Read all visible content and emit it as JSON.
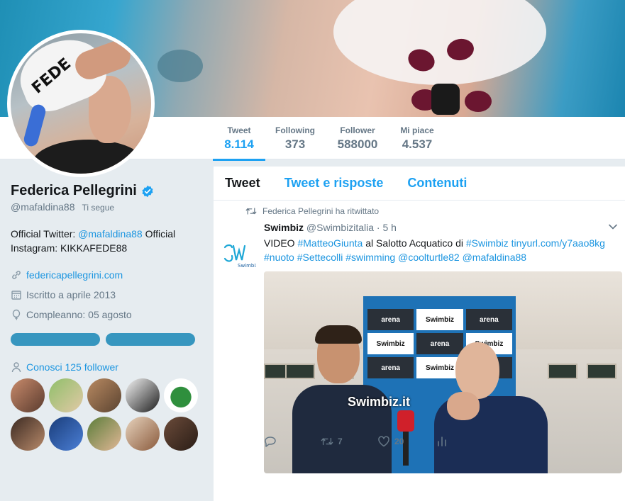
{
  "colors": {
    "accent": "#1da1f2",
    "link": "#1b95e0",
    "muted": "#657786",
    "verified": "#1da1f2"
  },
  "profile": {
    "name": "Federica Pellegrini",
    "handle": "@mafaldina88",
    "follows_you": "Ti segue",
    "bio_prefix": "Official Twitter: ",
    "bio_handle": "@mafaldina88",
    "bio_suffix": " Official Instagram: KIKKAFEDE88",
    "website": "federicapellegrini.com",
    "joined": "Iscritto a aprile 2013",
    "birthday": "Compleanno: 05 agosto",
    "followers_you_know": "Conosci 125 follower",
    "avatar_cap_text": "FEDE"
  },
  "stats": [
    {
      "label": "Tweet",
      "value": "8.114"
    },
    {
      "label": "Following",
      "value": "373"
    },
    {
      "label": "Follower",
      "value": "588000"
    },
    {
      "label": "Mi piace",
      "value": "4.537"
    }
  ],
  "tabs": [
    "Tweet",
    "Tweet e risposte",
    "Contenuti"
  ],
  "tweet": {
    "retweeted_by": "Federica Pellegrini ha ritwittato",
    "author": "Swimbiz",
    "author_handle": "@Swimbizitalia",
    "time": "· 5 h",
    "text_1": "VIDEO ",
    "tag_1": "#MatteoGiunta",
    "text_2": " al Salotto Acquatico di ",
    "tag_2": "#Swimbiz",
    "text_3": " ",
    "link": "tinyurl.com/y7aao8kg",
    "tag_3": "#nuoto",
    "tag_4": "#Settecolli",
    "tag_5": "#swimming",
    "mention_1": "@coolturtle82",
    "mention_2": "@mafaldina88",
    "media_watermark": "Swimbiz.it",
    "panel_brand": "arena",
    "panel_sponsor": "Swimbiz",
    "retweets": "7",
    "likes": "20"
  }
}
